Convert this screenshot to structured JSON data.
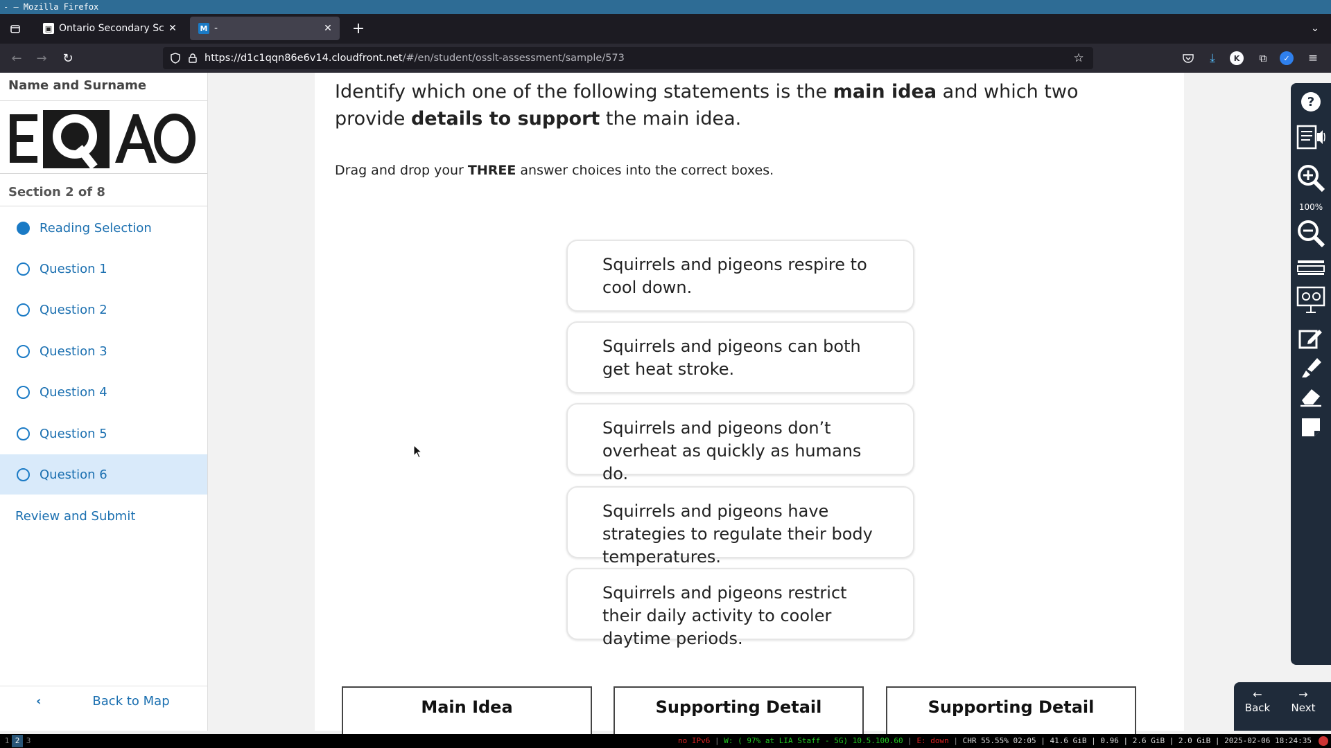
{
  "window": {
    "title": "- — Mozilla Firefox"
  },
  "tabs": [
    {
      "label": "Ontario Secondary School"
    },
    {
      "label": "-"
    }
  ],
  "urlbar": {
    "host": "https://d1c1qqn86e6v14.cloudfront.net",
    "path": "/#/en/student/osslt-assessment/sample/573"
  },
  "sidebar": {
    "student_name": "Name and Surname",
    "logo_text": "EQAO",
    "section": "Section 2 of 8",
    "items": [
      {
        "label": "Reading Selection",
        "state": "filled"
      },
      {
        "label": "Question 1"
      },
      {
        "label": "Question 2"
      },
      {
        "label": "Question 3"
      },
      {
        "label": "Question 4"
      },
      {
        "label": "Question 5"
      },
      {
        "label": "Question 6",
        "state": "active"
      }
    ],
    "review": "Review and Submit",
    "back_to_map": "Back to Map"
  },
  "question": {
    "p1": "Identify which one of the following statements is the ",
    "b1": "main idea",
    "p2": " and which two provide ",
    "b2": "details to support",
    "p3": " the main idea."
  },
  "instruction": {
    "pre": "Drag and drop your ",
    "bold": "THREE",
    "post": " answer choices into the correct boxes."
  },
  "choices": [
    "Squirrels and pigeons respire to cool down.",
    "Squirrels and pigeons can both get heat stroke.",
    "Squirrels and pigeons don’t overheat as quickly as humans do.",
    "Squirrels and pigeons have strategies to regulate their body temperatures.",
    "Squirrels and pigeons restrict their daily activity to cooler daytime periods."
  ],
  "targets": [
    "Main Idea",
    "Supporting Detail",
    "Supporting Detail"
  ],
  "toolbar": {
    "zoom": "100%"
  },
  "nav": {
    "back": "Back",
    "next": "Next"
  },
  "statusbar": {
    "workspaces": [
      "1",
      "2",
      "3"
    ],
    "ipv6": "no IPv6",
    "wifi": "W: ( 97% at LIA Staff - 5G) 10.5.100.60",
    "eth": "E: down",
    "rest": "CHR 55.55% 02:05 | 41.6 GiB | 0.96 | 2.6 GiB | 2.0 GiB | 2025-02-06 18:24:35"
  },
  "colors": {
    "link": "#1a6fb0",
    "accent": "#1a7ac5",
    "active_bg": "#d9eafa",
    "toolbar": "#1f2b3a"
  }
}
